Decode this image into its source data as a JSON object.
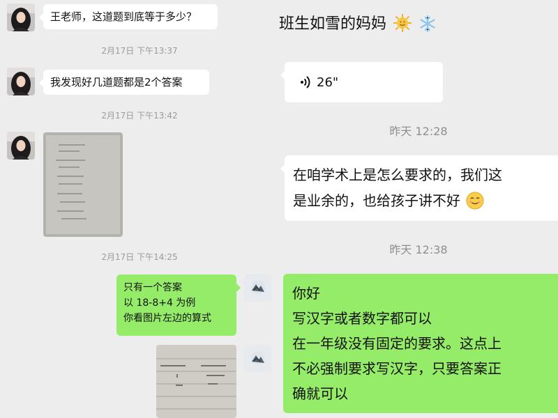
{
  "left": {
    "messages": [
      {
        "type": "text",
        "text": "王老师，这道题到底等于多少？"
      },
      {
        "type": "text",
        "text": "我发现好几道题都是2个答案"
      },
      {
        "type": "image",
        "name": "photo-of-math-homework"
      },
      {
        "type": "text",
        "lines": [
          "只有一个答案",
          "以 18-8+4 为例",
          "你看图片左边的算式"
        ]
      },
      {
        "type": "image",
        "name": "photo-of-worked-equation"
      }
    ],
    "timestamps": [
      "2月17日 下午13:37",
      "2月17日 下午13:42",
      "2月17日 下午14:25"
    ]
  },
  "right": {
    "title": "班生如雪的妈妈",
    "title_emojis": [
      "sun-emoji",
      "snowflake-emoji"
    ],
    "voice": {
      "duration": "26\""
    },
    "timestamps": [
      "昨天 12:28",
      "昨天 12:38"
    ],
    "messages": [
      {
        "type": "text",
        "lines": [
          "在咱学术上是怎么要求的，我们这",
          "是业余的，也给孩子讲不好"
        ],
        "emoji": "smile-emoji"
      },
      {
        "type": "text",
        "lines": [
          "你好",
          "写汉字或者数字都可以",
          "在一年级没有固定的要求。这点上",
          "不必强制要求写汉字，只要答案正",
          "确就可以"
        ]
      }
    ]
  },
  "colors": {
    "background": "#ededed",
    "incoming_bubble": "#ffffff",
    "outgoing_bubble": "#95ec69",
    "timestamp": "#9a9a9a"
  }
}
